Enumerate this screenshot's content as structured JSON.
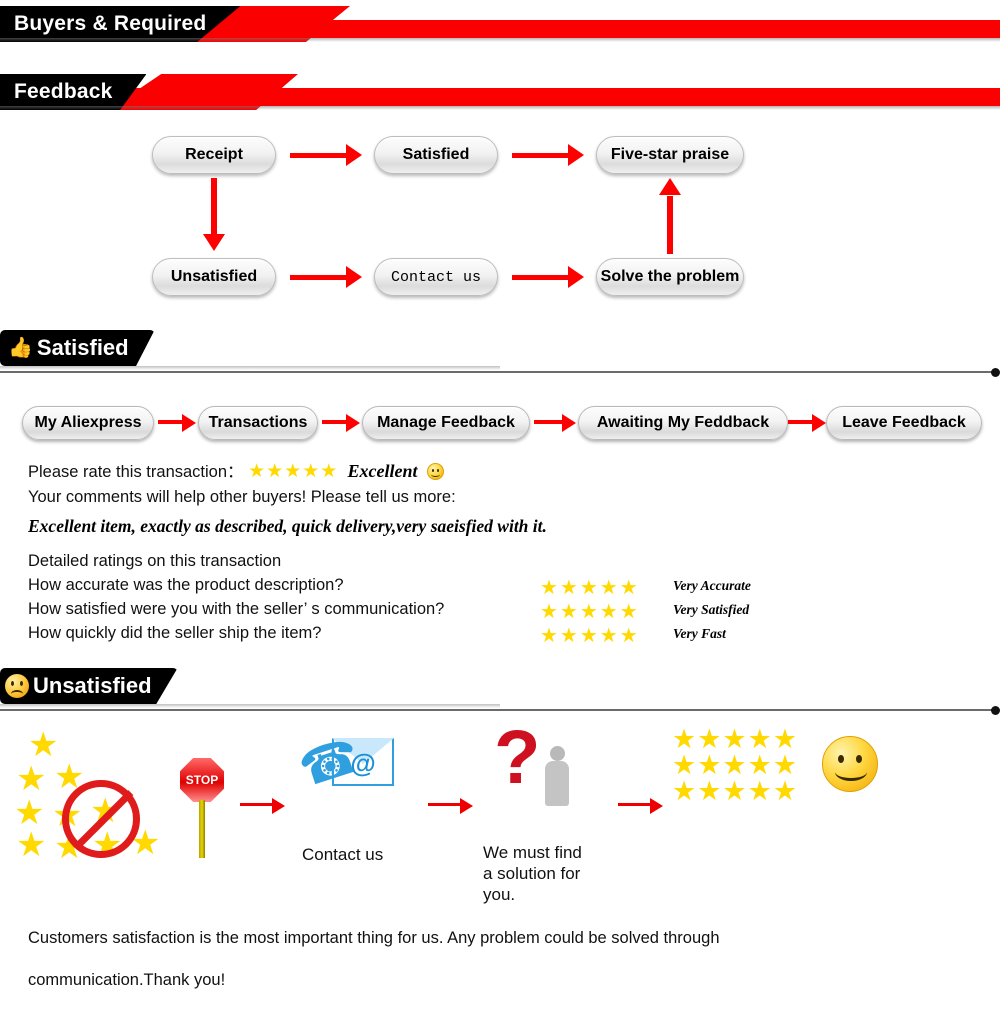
{
  "banners": [
    {
      "label": "Buyers & Required",
      "accent": "#fb0000",
      "bg": "#000000"
    },
    {
      "label": "Feedback",
      "accent": "#fb0000",
      "bg": "#000000"
    }
  ],
  "flowchart": {
    "nodes": [
      {
        "label": "Receipt"
      },
      {
        "label": "Satisfied"
      },
      {
        "label": "Five-star praise"
      },
      {
        "label": "Unsatisfied"
      },
      {
        "label": "Contact us"
      },
      {
        "label": "Solve the problem"
      }
    ],
    "arrow_color": "#ff0000"
  },
  "satisfied_section": {
    "heading": "Satisfied",
    "icon": "thumbs-up-icon",
    "nav_chain": [
      {
        "label": "My Aliexpress"
      },
      {
        "label": "Transactions"
      },
      {
        "label": "Manage Feedback"
      },
      {
        "label": "Awaiting My Feddback"
      },
      {
        "label": "Leave Feedback"
      }
    ],
    "rate_prompt": "Please rate this transaction：",
    "rate_stars": "★★★★★",
    "rate_word": "Excellent",
    "comments_prompt": "Your comments will help other buyers! Please tell us more:",
    "comment_text": "Excellent item, exactly as described, quick delivery,very saeisfied with it.",
    "details_title": "Detailed ratings on this transaction",
    "detail_rows": [
      {
        "question": "How accurate was the product description?",
        "stars": "★★★★★",
        "label": "Very Accurate"
      },
      {
        "question": "How satisfied were you with the seller’ s communication?",
        "stars": "★★★★★",
        "label": "Very Satisfied"
      },
      {
        "question": "How quickly did the seller ship the item?",
        "stars": "★★★★★",
        "label": "Very Fast"
      }
    ],
    "star_color": "#ffd900"
  },
  "unsatisfied_section": {
    "heading": "Unsatisfied",
    "icon": "sad-face-icon",
    "steps": [
      {
        "icon": "crossed-out-stars-icon",
        "caption": ""
      },
      {
        "icon": "stop-sign-icon",
        "caption": "",
        "sign_text": "STOP"
      },
      {
        "icon": "phone-email-icon",
        "caption": "Contact us"
      },
      {
        "icon": "question-mark-person-icon",
        "caption": "We must find\na solution for\nyou."
      },
      {
        "icon": "full-stars-icon",
        "caption": ""
      },
      {
        "icon": "smiley-face-icon",
        "caption": ""
      }
    ],
    "big_star_rows": [
      "★★★★★",
      "★★★★★",
      "★★★★★"
    ],
    "arrow_color": "#ee0000"
  },
  "footer": {
    "line1": "Customers satisfaction is the most important thing for us. Any problem could be solved through",
    "line2": "communication.Thank you!"
  }
}
